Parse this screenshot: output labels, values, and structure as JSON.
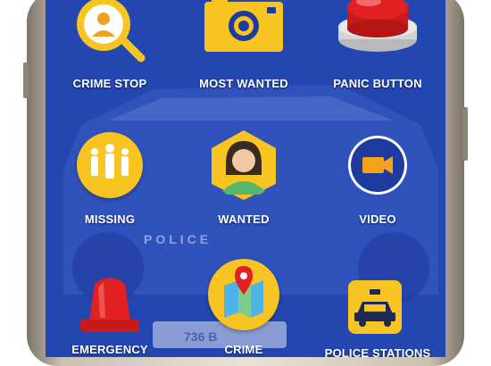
{
  "app": {
    "tiles": [
      {
        "label": "CRIME STOP",
        "icon": "magnifier-person-icon"
      },
      {
        "label": "MOST WANTED",
        "icon": "camera-icon"
      },
      {
        "label": "PANIC BUTTON",
        "icon": "red-panic-button-icon"
      },
      {
        "label": "MISSING",
        "icon": "people-group-icon"
      },
      {
        "label": "WANTED",
        "icon": "woman-avatar-icon"
      },
      {
        "label": "VIDEO",
        "icon": "video-camera-icon"
      },
      {
        "label": "EMERGENCY",
        "icon": "siren-light-icon"
      },
      {
        "label": "CRIME",
        "icon": "map-pin-icon"
      },
      {
        "label": "POLICE STATIONS",
        "icon": "police-car-icon"
      }
    ],
    "background": {
      "car_plate": "736 B",
      "car_text": "POLICE"
    }
  },
  "colors": {
    "screen_blue": "#2446b0",
    "accent_yellow": "#f7c422",
    "label_white": "#ffffff",
    "panic_red": "#e0211f"
  }
}
